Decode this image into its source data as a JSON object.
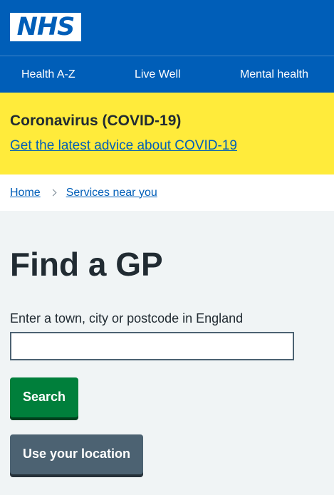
{
  "header": {
    "logo_text": "NHS",
    "nav": [
      {
        "label": "Health A-Z"
      },
      {
        "label": "Live Well"
      },
      {
        "label": "Mental health"
      }
    ]
  },
  "covid_banner": {
    "title": "Coronavirus (COVID-19)",
    "link": "Get the latest advice about COVID-19"
  },
  "breadcrumb": {
    "items": [
      {
        "label": "Home"
      },
      {
        "label": "Services near you"
      }
    ]
  },
  "main": {
    "title": "Find a GP",
    "search_label": "Enter a town, city or postcode in England",
    "search_value": "",
    "search_button": "Search",
    "location_button": "Use your location"
  },
  "colors": {
    "nhs_blue": "#005eb8",
    "banner_yellow": "#ffeb3b",
    "button_green": "#007f3b",
    "button_grey": "#4c6272",
    "page_background": "#f0f4f5"
  },
  "icons": {
    "breadcrumb_separator": "chevron-right-icon"
  }
}
